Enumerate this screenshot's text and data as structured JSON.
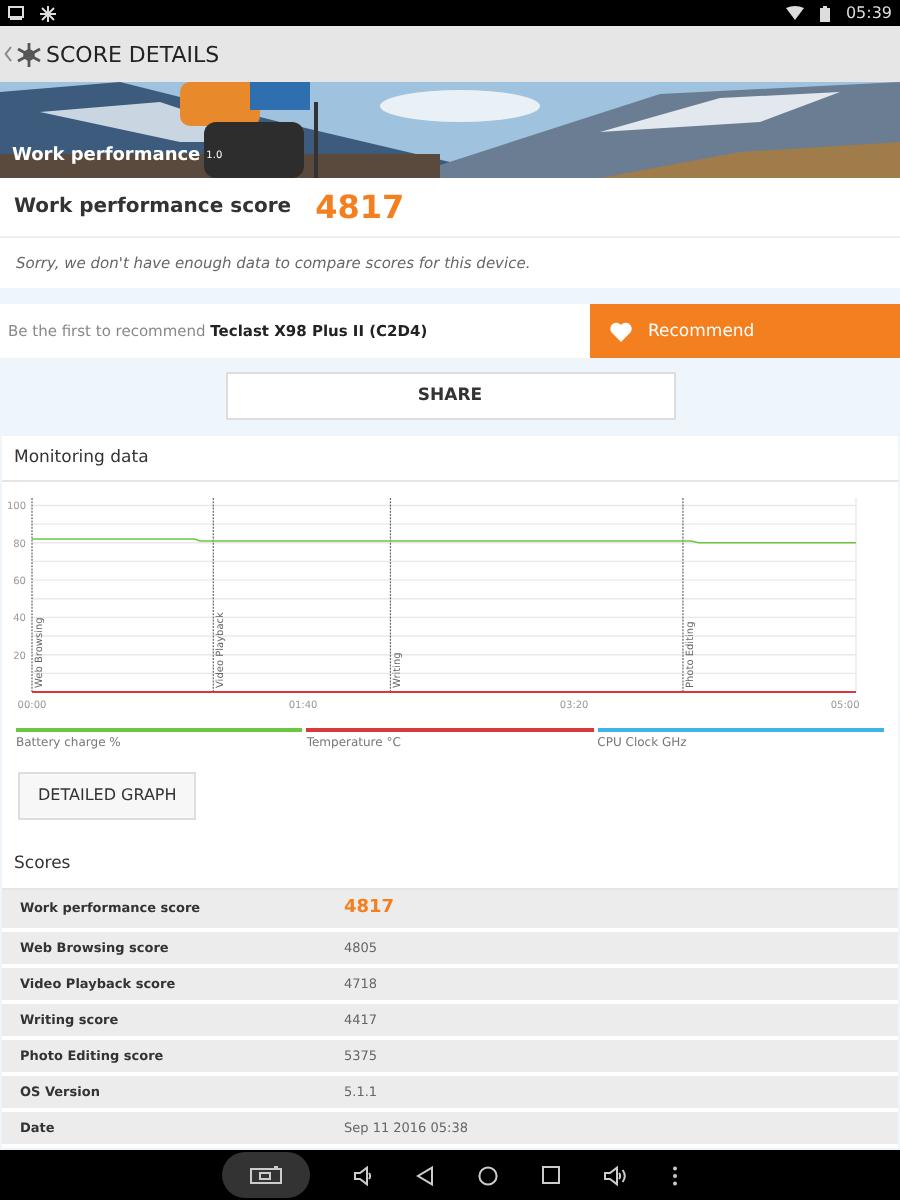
{
  "status_bar": {
    "time": "05:39"
  },
  "app_bar": {
    "title": "SCORE DETAILS"
  },
  "banner": {
    "kind": "picture",
    "title": "Work performance",
    "version": "1.0"
  },
  "score": {
    "label": "Work performance score",
    "value": "4817"
  },
  "notice": "Sorry, we don't have enough data to compare scores for this device.",
  "recommend": {
    "text": "Be the first to recommend **Teclast X98 Plus II (C2D4)**",
    "button": "Recommend"
  },
  "share_button": "SHARE",
  "monitoring": {
    "title": "Monitoring data",
    "chart_data": {
      "type": "line",
      "x": [
        0,
        60,
        62,
        243,
        246,
        304
      ],
      "ylim": [
        0,
        104
      ],
      "xlim": [
        0,
        304
      ],
      "grid": true,
      "yticks": [
        20,
        40,
        60,
        80,
        100
      ],
      "xticks": [
        {
          "value": 0,
          "label": "00:00"
        },
        {
          "value": 100,
          "label": "01:40"
        },
        {
          "value": 200,
          "label": "03:20"
        },
        {
          "value": 300,
          "label": "05:00"
        }
      ],
      "series": [
        {
          "name": "Battery charge %",
          "color": "#6cc644",
          "values": [
            82,
            82,
            81,
            81,
            80,
            80
          ]
        },
        {
          "name": "Temperature °C",
          "color": "#d9383a",
          "values": [
            0,
            0,
            0,
            0,
            0,
            0
          ]
        },
        {
          "name": "CPU Clock GHz",
          "color": "#3fb2e8",
          "values": [
            null,
            null,
            null,
            null,
            null,
            null
          ]
        }
      ],
      "annotations": [
        "Web Browsing",
        "Video Playback",
        "Writing",
        "Photo Editing"
      ]
    },
    "button": "DETAILED GRAPH"
  },
  "scores": {
    "title": "Scores",
    "rows": [
      {
        "label": "Work performance score",
        "value": "4817",
        "kind": "main"
      },
      {
        "label": "Web Browsing score",
        "value": "4805",
        "kind": "plain"
      },
      {
        "label": "Video Playback score",
        "value": "4718",
        "kind": "plain"
      },
      {
        "label": "Writing score",
        "value": "4417",
        "kind": "plain"
      },
      {
        "label": "Photo Editing score",
        "value": "5375",
        "kind": "plain"
      },
      {
        "label": "OS Version",
        "value": "5.1.1",
        "kind": "plain"
      },
      {
        "label": "Date",
        "value": "Sep 11 2016 05:38",
        "kind": "plain"
      }
    ]
  }
}
